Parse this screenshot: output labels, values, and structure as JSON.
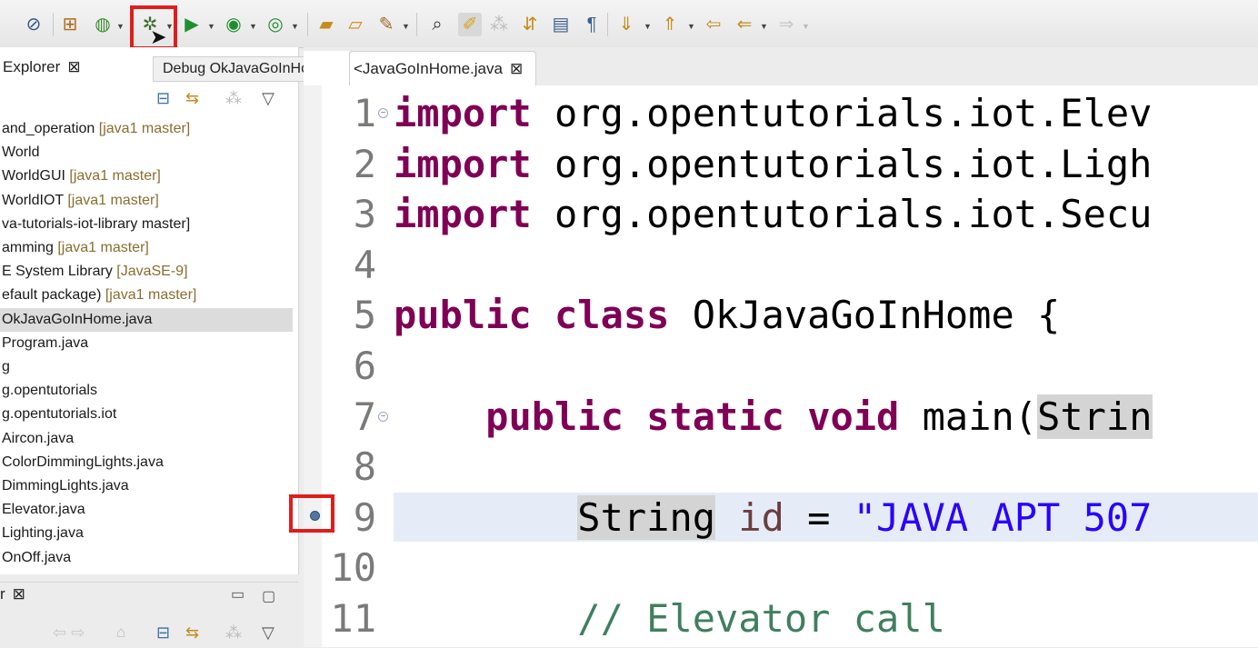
{
  "toolbar": {
    "tooltip": "Debug OkJavaGoInHome",
    "icons": [
      "skip-breakpoints",
      "new-package",
      "new-class",
      "debug",
      "run",
      "coverage",
      "external-tools",
      "open-type",
      "open-task",
      "search",
      "toggle-mark",
      "highlight",
      "next-annotation",
      "prev-annotation",
      "last-edit",
      "back",
      "forward"
    ]
  },
  "explorer": {
    "tab_label": "Explorer",
    "rows": [
      {
        "text": "and_operation",
        "deco": "[java1 master]"
      },
      {
        "text": "World",
        "deco": ""
      },
      {
        "text": "WorldGUI",
        "deco": "[java1 master]"
      },
      {
        "text": "WorldIOT",
        "deco": "[java1 master]"
      },
      {
        "text": "va-tutorials-iot-library master]",
        "deco": ""
      },
      {
        "text": "amming",
        "deco": "[java1 master]"
      },
      {
        "text": "E System Library",
        "deco": "[JavaSE-9]"
      },
      {
        "text": "efault package)",
        "deco": "[java1 master]"
      },
      {
        "text": "OkJavaGoInHome.java",
        "deco": ""
      },
      {
        "text": "Program.java",
        "deco": ""
      },
      {
        "text": "g",
        "deco": ""
      },
      {
        "text": "g.opentutorials",
        "deco": ""
      },
      {
        "text": "g.opentutorials.iot",
        "deco": ""
      },
      {
        "text": "Aircon.java",
        "deco": ""
      },
      {
        "text": "ColorDimmingLights.java",
        "deco": ""
      },
      {
        "text": "DimmingLights.java",
        "deco": ""
      },
      {
        "text": "Elevator.java",
        "deco": ""
      },
      {
        "text": "Lighting.java",
        "deco": ""
      },
      {
        "text": "OnOff.java",
        "deco": ""
      }
    ]
  },
  "lower_panel": {
    "tab_label": "r"
  },
  "editor": {
    "tab_label": "<JavaGoInHome.java",
    "lines": [
      {
        "n": "1",
        "html": "<span class=\"kw\">import</span> org.opentutorials.iot.Elev"
      },
      {
        "n": "2",
        "html": "<span class=\"kw\">import</span> org.opentutorials.iot.Ligh"
      },
      {
        "n": "3",
        "html": "<span class=\"kw\">import</span> org.opentutorials.iot.Secu"
      },
      {
        "n": "4",
        "html": ""
      },
      {
        "n": "5",
        "html": "<span class=\"kw\">public</span> <span class=\"kw\">class</span> OkJavaGoInHome {"
      },
      {
        "n": "6",
        "html": ""
      },
      {
        "n": "7",
        "html": "    <span class=\"kw\">public</span> <span class=\"kw\">static</span> <span class=\"kw\">void</span> main(<span class=\"hl-occ\">Strin</span>"
      },
      {
        "n": "8",
        "html": ""
      },
      {
        "n": "9",
        "html": "        <span class=\"hl-occ\">String</span> <span class=\"var\">id</span> = <span class=\"str\">\"JAVA APT 507</span>"
      },
      {
        "n": "10",
        "html": ""
      },
      {
        "n": "11",
        "html": "        <span class=\"cmt\">// Elevator call</span>"
      }
    ]
  }
}
